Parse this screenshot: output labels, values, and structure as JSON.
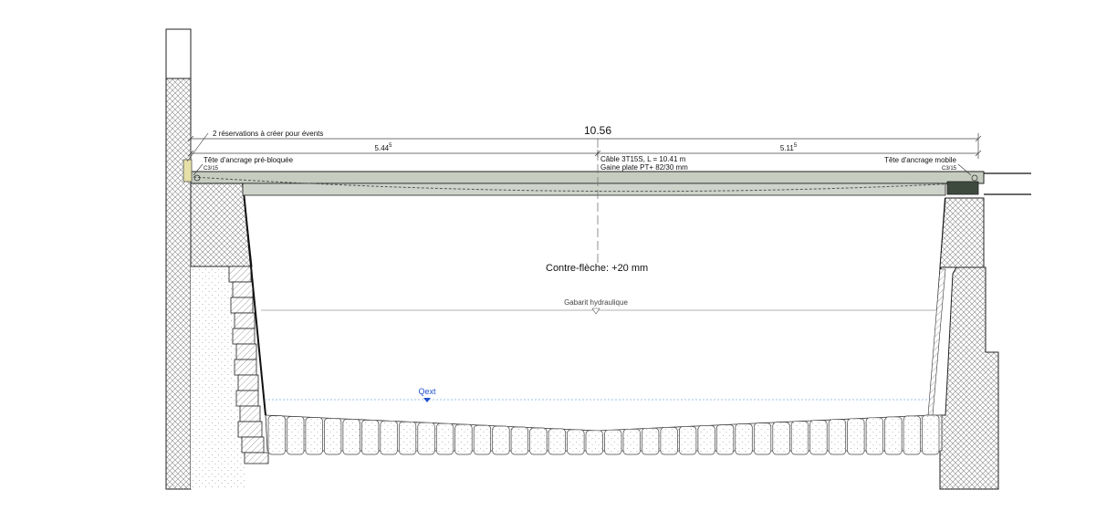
{
  "dimensions": {
    "total": "10.56",
    "left_main": "5.44",
    "left_sup": "5",
    "right_main": "5.11",
    "right_sup": "5"
  },
  "notes": {
    "reservations": "2 réservations à créer pour évents",
    "anchor_left": "Tête d'ancrage pré-bloquée",
    "anchor_left_ref": "C3/15",
    "anchor_right": "Tête d'ancrage mobile",
    "anchor_right_ref": "C3/15",
    "cable_line1": "Câble 3T15S, L = 10.41 m",
    "cable_line2": "Gaine plate PT+ 82/30 mm",
    "camber": "Contre-flèche: +20 mm",
    "hydraulic": "Gabarit hydraulique",
    "qext": "Qext"
  },
  "colors": {
    "deck_fill": "#c6cdc0",
    "anchor_block": "#e6dfa8",
    "qext_text": "#1f4fd0",
    "qext_line": "#7fb0e0"
  }
}
